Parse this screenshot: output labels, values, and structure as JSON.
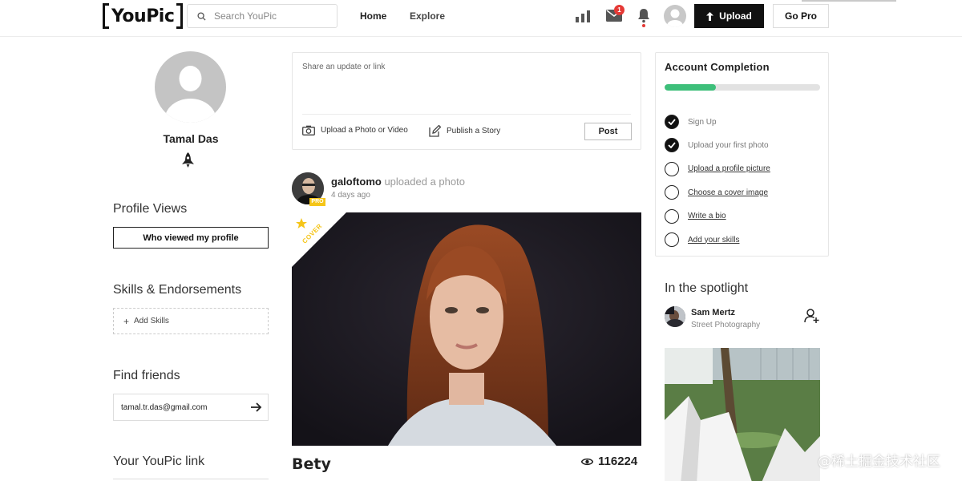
{
  "header": {
    "logo": "YouPic",
    "search_placeholder": "Search YouPic",
    "nav": {
      "home": "Home",
      "explore": "Explore"
    },
    "messages_count": "1",
    "upload_label": "Upload",
    "gopro_label": "Go Pro"
  },
  "profile": {
    "name": "Tamal Das",
    "views_title": "Profile Views",
    "views_button": "Who viewed my profile",
    "skills_title": "Skills & Endorsements",
    "add_skills": "Add Skills",
    "friends_title": "Find friends",
    "friends_email": "tamal.tr.das@gmail.com",
    "link_title": "Your YouPic link"
  },
  "composer": {
    "placeholder": "Share an update or link",
    "upload_photo": "Upload a Photo or Video",
    "publish_story": "Publish a Story",
    "post_label": "Post"
  },
  "post": {
    "user": "galoftomo",
    "action": "uploaded a photo",
    "pro_badge": "PRO",
    "time": "4 days ago",
    "cover_label": "COVER",
    "photo_title": "Bety",
    "views": "116224"
  },
  "account": {
    "title": "Account Completion",
    "progress": 0.33,
    "steps": [
      {
        "label": "Sign Up",
        "done": true
      },
      {
        "label": "Upload your first photo",
        "done": true
      },
      {
        "label": "Upload a profile picture",
        "done": false
      },
      {
        "label": "Choose a cover image",
        "done": false
      },
      {
        "label": "Write a bio",
        "done": false
      },
      {
        "label": "Add your skills",
        "done": false
      }
    ]
  },
  "spotlight": {
    "title": "In the spotlight",
    "name": "Sam Mertz",
    "category": "Street Photography"
  },
  "watermark": "@稀土掘金技术社区",
  "colors": {
    "accent_green": "#3dbf7a",
    "badge_red": "#e53935",
    "pro_gold": "#f5c518",
    "button_dark": "#111111"
  }
}
